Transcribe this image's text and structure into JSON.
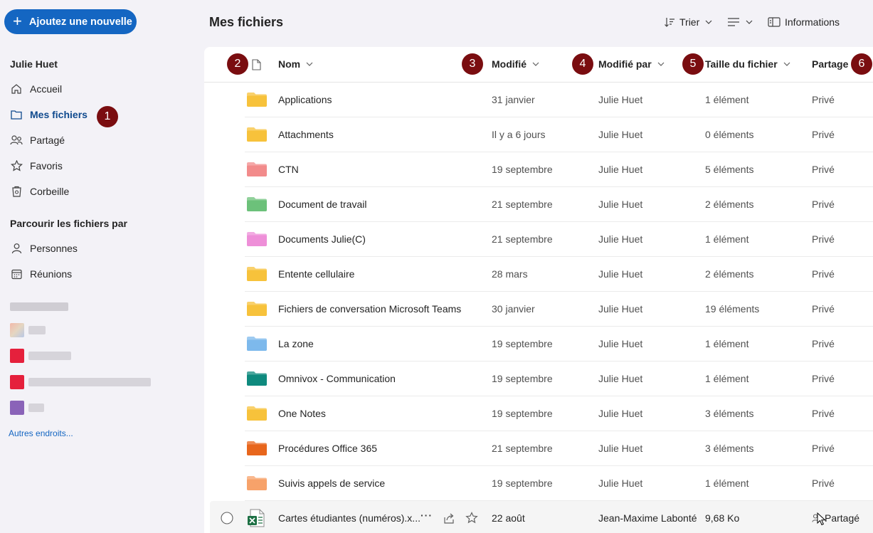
{
  "sidebar": {
    "new_button": "Ajoutez une nouvelle",
    "user_name": "Julie Huet",
    "nav": [
      {
        "label": "Accueil",
        "icon": "home-icon"
      },
      {
        "label": "Mes fichiers",
        "icon": "folder-icon"
      },
      {
        "label": "Partagé",
        "icon": "people-icon"
      },
      {
        "label": "Favoris",
        "icon": "star-icon"
      },
      {
        "label": "Corbeille",
        "icon": "trash-icon"
      }
    ],
    "browse_title": "Parcourir les fichiers par",
    "browse": [
      {
        "label": "Personnes",
        "icon": "person-icon"
      },
      {
        "label": "Réunions",
        "icon": "calendar-icon"
      }
    ],
    "other_places": "Autres endroits..."
  },
  "header": {
    "title": "Mes fichiers",
    "sort_label": "Trier",
    "info_label": "Informations"
  },
  "columns": {
    "name": "Nom",
    "modified": "Modifié",
    "modified_by": "Modifié par",
    "size": "Taille du fichier",
    "sharing": "Partage"
  },
  "badges": [
    "1",
    "2",
    "3",
    "4",
    "5",
    "6"
  ],
  "rows": [
    {
      "name": "Applications",
      "modified": "31 janvier",
      "by": "Julie Huet",
      "size": "1 élément",
      "share": "Privé",
      "color": "#f7c23b"
    },
    {
      "name": "Attachments",
      "modified": "Il y a 6 jours",
      "by": "Julie Huet",
      "size": "0 éléments",
      "share": "Privé",
      "color": "#f7c23b"
    },
    {
      "name": "CTN",
      "modified": "19 septembre",
      "by": "Julie Huet",
      "size": "5 éléments",
      "share": "Privé",
      "color": "#f28b8b"
    },
    {
      "name": "Document de travail",
      "modified": "21 septembre",
      "by": "Julie Huet",
      "size": "2 éléments",
      "share": "Privé",
      "color": "#6cc17a"
    },
    {
      "name": "Documents Julie(C)",
      "modified": "21 septembre",
      "by": "Julie Huet",
      "size": "1 élément",
      "share": "Privé",
      "color": "#ee8fd8"
    },
    {
      "name": "Entente cellulaire",
      "modified": "28 mars",
      "by": "Julie Huet",
      "size": "2 éléments",
      "share": "Privé",
      "color": "#f7c23b"
    },
    {
      "name": "Fichiers de conversation Microsoft Teams",
      "modified": "30 janvier",
      "by": "Julie Huet",
      "size": "19 éléments",
      "share": "Privé",
      "color": "#f7c23b"
    },
    {
      "name": "La zone",
      "modified": "19 septembre",
      "by": "Julie Huet",
      "size": "1 élément",
      "share": "Privé",
      "color": "#7db9ec"
    },
    {
      "name": "Omnivox - Communication",
      "modified": "19 septembre",
      "by": "Julie Huet",
      "size": "1 élément",
      "share": "Privé",
      "color": "#0f8a7e"
    },
    {
      "name": "One Notes",
      "modified": "19 septembre",
      "by": "Julie Huet",
      "size": "3 éléments",
      "share": "Privé",
      "color": "#f7c23b"
    },
    {
      "name": "Procédures Office 365",
      "modified": "21 septembre",
      "by": "Julie Huet",
      "size": "3 éléments",
      "share": "Privé",
      "color": "#e8661c"
    },
    {
      "name": "Suivis appels de service",
      "modified": "19 septembre",
      "by": "Julie Huet",
      "size": "1 élément",
      "share": "Privé",
      "color": "#f7a26a"
    }
  ],
  "file_row": {
    "name": "Cartes étudiantes (numéros).x...",
    "modified": "22 août",
    "by": "Jean-Maxime Labonté",
    "size": "9,68 Ko",
    "share": "Partagé"
  }
}
